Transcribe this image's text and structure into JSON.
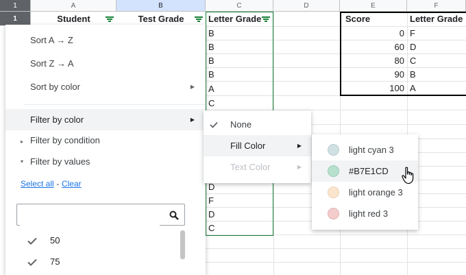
{
  "grid": {
    "corner_row": "1",
    "columns": [
      "A",
      "B",
      "C",
      "D",
      "E",
      "F"
    ],
    "headers": {
      "student": "Student",
      "test_grade": "Test Grade",
      "letter_grade": "Letter Grade"
    },
    "col_c_values": [
      "B",
      "B",
      "B",
      "B",
      "A",
      "C",
      "D",
      "F",
      "D",
      "C"
    ],
    "lookup": {
      "score_header": "Score",
      "letter_header": "Letter Grade",
      "rows": [
        {
          "score": "0",
          "letter": "F"
        },
        {
          "score": "60",
          "letter": "D"
        },
        {
          "score": "80",
          "letter": "C"
        },
        {
          "score": "90",
          "letter": "B"
        },
        {
          "score": "100",
          "letter": "A"
        }
      ]
    }
  },
  "filter_menu": {
    "sort_az": "Sort A → Z",
    "sort_za": "Sort Z → A",
    "sort_by_color": "Sort by color",
    "filter_by_color": "Filter by color",
    "filter_by_condition": "Filter by condition",
    "filter_by_values": "Filter by values",
    "select_all": "Select all",
    "link_sep": "-",
    "clear": "Clear",
    "search_placeholder": "",
    "values": [
      "50",
      "75"
    ]
  },
  "color_submenu": {
    "none": "None",
    "fill_color": "Fill Color",
    "text_color": "Text Color"
  },
  "fill_colors": [
    {
      "label": "light cyan 3",
      "color": "#d0e0e3"
    },
    {
      "label": "#B7E1CD",
      "color": "#b7e1cd"
    },
    {
      "label": "light orange 3",
      "color": "#fce5cd"
    },
    {
      "label": "light red 3",
      "color": "#f4cccc"
    }
  ]
}
